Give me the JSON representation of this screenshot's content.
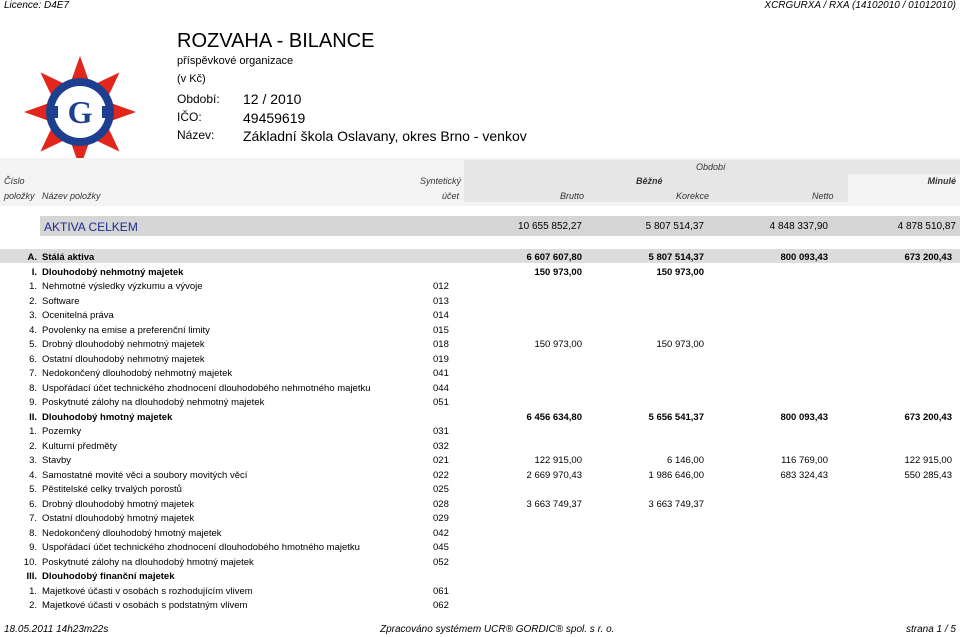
{
  "topbar": {
    "left": "Licence: D4E7",
    "right": "XCRGURXA / RXA  (14102010 / 01012010)"
  },
  "header": {
    "title": "ROZVAHA - BILANCE",
    "subtitle": "příspěvkové organizace",
    "unit": "(v Kč)",
    "period_label": "Období:",
    "period_value": "12 / 2010",
    "ico_label": "IČO:",
    "ico_value": "49459619",
    "name_label": "Název:",
    "name_value": "Základní škola Oslavany, okres Brno - venkov"
  },
  "logo": {
    "letter": "G",
    "colors": {
      "red": "#e2261c",
      "blue": "#1d3f8f"
    }
  },
  "columns": {
    "obdobi": "Období",
    "cislo": "Číslo",
    "polozky": "položky",
    "nazev": "Název položky",
    "synteticky": "Syntetický",
    "ucet": "účet",
    "bezne": "Běžné",
    "minule": "Minulé",
    "brutto": "Brutto",
    "korekce": "Korekce",
    "netto": "Netto"
  },
  "total": {
    "label": "AKTIVA CELKEM",
    "brutto": "10 655 852,27",
    "korekce": "5 807 514,37",
    "netto": "4 848 337,90",
    "minule": "4 878 510,87"
  },
  "rows": [
    {
      "num": "A.",
      "name": "Stálá aktiva",
      "acct": "",
      "brutto": "6 607 607,80",
      "korekce": "5 807 514,37",
      "netto": "800 093,43",
      "minule": "673 200,43",
      "bold": true,
      "level": 0
    },
    {
      "num": "I.",
      "name": "Dlouhodobý nehmotný majetek",
      "acct": "",
      "brutto": "150 973,00",
      "korekce": "150 973,00",
      "netto": "",
      "minule": "",
      "bold": true,
      "level": 1
    },
    {
      "num": "1.",
      "name": "Nehmotné výsledky výzkumu a vývoje",
      "acct": "012",
      "brutto": "",
      "korekce": "",
      "netto": "",
      "minule": "",
      "level": 2
    },
    {
      "num": "2.",
      "name": "Software",
      "acct": "013",
      "brutto": "",
      "korekce": "",
      "netto": "",
      "minule": "",
      "level": 2
    },
    {
      "num": "3.",
      "name": "Ocenitelná práva",
      "acct": "014",
      "brutto": "",
      "korekce": "",
      "netto": "",
      "minule": "",
      "level": 2
    },
    {
      "num": "4.",
      "name": "Povolenky na emise a preferenční limity",
      "acct": "015",
      "brutto": "",
      "korekce": "",
      "netto": "",
      "minule": "",
      "level": 2
    },
    {
      "num": "5.",
      "name": "Drobný dlouhodobý nehmotný majetek",
      "acct": "018",
      "brutto": "150 973,00",
      "korekce": "150 973,00",
      "netto": "",
      "minule": "",
      "level": 2
    },
    {
      "num": "6.",
      "name": "Ostatní dlouhodobý nehmotný majetek",
      "acct": "019",
      "brutto": "",
      "korekce": "",
      "netto": "",
      "minule": "",
      "level": 2
    },
    {
      "num": "7.",
      "name": "Nedokončený dlouhodobý nehmotný majetek",
      "acct": "041",
      "brutto": "",
      "korekce": "",
      "netto": "",
      "minule": "",
      "level": 2
    },
    {
      "num": "8.",
      "name": "Uspořádací účet technického zhodnocení dlouhodobého nehmotného majetku",
      "acct": "044",
      "brutto": "",
      "korekce": "",
      "netto": "",
      "minule": "",
      "level": 2
    },
    {
      "num": "9.",
      "name": "Poskytnuté zálohy na dlouhodobý nehmotný majetek",
      "acct": "051",
      "brutto": "",
      "korekce": "",
      "netto": "",
      "minule": "",
      "level": 2
    },
    {
      "num": "II.",
      "name": "Dlouhodobý hmotný majetek",
      "acct": "",
      "brutto": "6 456 634,80",
      "korekce": "5 656 541,37",
      "netto": "800 093,43",
      "minule": "673 200,43",
      "bold": true,
      "level": 1
    },
    {
      "num": "1.",
      "name": "Pozemky",
      "acct": "031",
      "brutto": "",
      "korekce": "",
      "netto": "",
      "minule": "",
      "level": 2
    },
    {
      "num": "2.",
      "name": "Kulturní předměty",
      "acct": "032",
      "brutto": "",
      "korekce": "",
      "netto": "",
      "minule": "",
      "level": 2
    },
    {
      "num": "3.",
      "name": "Stavby",
      "acct": "021",
      "brutto": "122 915,00",
      "korekce": "6 146,00",
      "netto": "116 769,00",
      "minule": "122 915,00",
      "level": 2
    },
    {
      "num": "4.",
      "name": "Samostatné movité věci a soubory movitých věcí",
      "acct": "022",
      "brutto": "2 669 970,43",
      "korekce": "1 986 646,00",
      "netto": "683 324,43",
      "minule": "550 285,43",
      "level": 2
    },
    {
      "num": "5.",
      "name": "Pěstitelské celky trvalých porostů",
      "acct": "025",
      "brutto": "",
      "korekce": "",
      "netto": "",
      "minule": "",
      "level": 2
    },
    {
      "num": "6.",
      "name": "Drobný dlouhodobý hmotný majetek",
      "acct": "028",
      "brutto": "3 663 749,37",
      "korekce": "3 663 749,37",
      "netto": "",
      "minule": "",
      "level": 2
    },
    {
      "num": "7.",
      "name": "Ostatní dlouhodobý hmotný majetek",
      "acct": "029",
      "brutto": "",
      "korekce": "",
      "netto": "",
      "minule": "",
      "level": 2
    },
    {
      "num": "8.",
      "name": "Nedokončený dlouhodobý hmotný majetek",
      "acct": "042",
      "brutto": "",
      "korekce": "",
      "netto": "",
      "minule": "",
      "level": 2
    },
    {
      "num": "9.",
      "name": "Uspořádací účet technického zhodnocení dlouhodobého hmotného majetku",
      "acct": "045",
      "brutto": "",
      "korekce": "",
      "netto": "",
      "minule": "",
      "level": 2
    },
    {
      "num": "10.",
      "name": "Poskytnuté zálohy na dlouhodobý hmotný majetek",
      "acct": "052",
      "brutto": "",
      "korekce": "",
      "netto": "",
      "minule": "",
      "level": 2
    },
    {
      "num": "III.",
      "name": "Dlouhodobý finanční majetek",
      "acct": "",
      "brutto": "",
      "korekce": "",
      "netto": "",
      "minule": "",
      "bold": true,
      "level": 1
    },
    {
      "num": "1.",
      "name": "Majetkové účasti v osobách s rozhodujícím vlivem",
      "acct": "061",
      "brutto": "",
      "korekce": "",
      "netto": "",
      "minule": "",
      "level": 2
    },
    {
      "num": "2.",
      "name": "Majetkové účasti v osobách s podstatným vlivem",
      "acct": "062",
      "brutto": "",
      "korekce": "",
      "netto": "",
      "minule": "",
      "level": 2
    }
  ],
  "footer": {
    "left": "18.05.2011 14h23m22s",
    "center": "Zpracováno systémem  UCR® GORDIC® spol. s  r. o.",
    "right": "strana 1 / 5"
  }
}
